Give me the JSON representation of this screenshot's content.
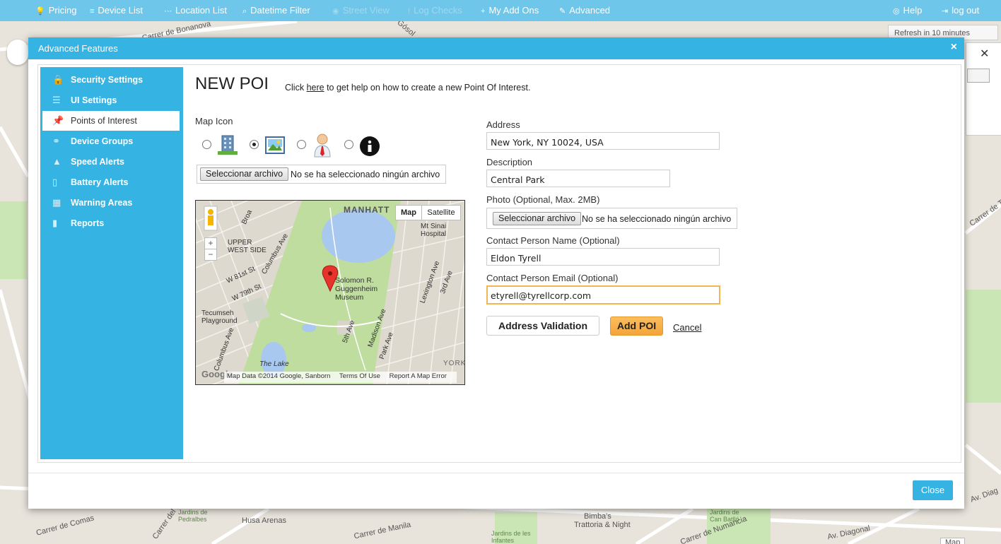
{
  "nav": {
    "items": [
      {
        "icon": "lightbulb-icon",
        "glyph": "💡",
        "label": "Pricing"
      },
      {
        "icon": "list-icon",
        "glyph": "≡",
        "label": "Device List"
      },
      {
        "icon": "dotted-list-icon",
        "glyph": "⋯",
        "label": "Location List"
      },
      {
        "icon": "search-icon",
        "glyph": "⌕",
        "label": "Datetime Filter"
      },
      {
        "icon": "eye-icon",
        "glyph": "◉",
        "label": "Street View"
      },
      {
        "icon": "exclamation-icon",
        "glyph": "!",
        "label": "Log Checks"
      },
      {
        "icon": "plus-icon",
        "glyph": "+",
        "label": "My Add Ons"
      },
      {
        "icon": "wrench-icon",
        "glyph": "✎",
        "label": "Advanced"
      }
    ],
    "help": "Help",
    "logout": "log out"
  },
  "background": {
    "refresh": "Refresh in 10 minutes",
    "labels": [
      "Carrer de Bonanova",
      "Gósol",
      "Carrer de Comas",
      "Husa Arenas",
      "Carrer de Manila",
      "Bimba's",
      "Trattoria & Night",
      "Jardins de Can Batlló",
      "Av. Diagonal",
      "Jardins de les Infantes",
      "Jardins de Pedralbes",
      "Carrer del Dr",
      "Carrer de Numancia",
      "Carrer de Tuset",
      "Av. Diag",
      "Map"
    ]
  },
  "modal": {
    "title": "Advanced Features",
    "close_x": "×",
    "close_button": "Close"
  },
  "sidebar": {
    "items": [
      {
        "icon": "lock-icon",
        "glyph": "🔒",
        "label": "Security Settings"
      },
      {
        "icon": "layers-icon",
        "glyph": "☰",
        "label": "UI Settings"
      },
      {
        "icon": "pushpin-icon",
        "glyph": "📌",
        "label": "Points of Interest"
      },
      {
        "icon": "group-icon",
        "glyph": "⚭",
        "label": "Device Groups"
      },
      {
        "icon": "warning-icon",
        "glyph": "▲",
        "label": "Speed Alerts"
      },
      {
        "icon": "battery-icon",
        "glyph": "▯",
        "label": "Battery Alerts"
      },
      {
        "icon": "map-area-icon",
        "glyph": "▦",
        "label": "Warning Areas"
      },
      {
        "icon": "bar-chart-icon",
        "glyph": "▮",
        "label": "Reports"
      }
    ]
  },
  "form": {
    "title": "NEW POI",
    "help_pre": "Click ",
    "help_link": "here",
    "help_post": " to get help on how to create a new Point Of Interest.",
    "map_icon_label": "Map Icon",
    "icon_options": [
      {
        "icon": "building-icon",
        "checked": false
      },
      {
        "icon": "picture-icon",
        "checked": true
      },
      {
        "icon": "person-icon",
        "checked": false
      },
      {
        "icon": "info-icon",
        "checked": false
      }
    ],
    "file_button": "Seleccionar archivo",
    "file_status": "No se ha seleccionado ningún archivo",
    "address_label": "Address",
    "address_value": "New York, NY 10024, USA",
    "description_label": "Description",
    "description_value": "Central Park",
    "photo_label": "Photo (Optional, Max. 2MB)",
    "photo_button": "Seleccionar archivo",
    "photo_status": "No se ha seleccionado ningún archivo",
    "contact_name_label": "Contact Person Name (Optional)",
    "contact_name_value": "Eldon Tyrell",
    "contact_email_label": "Contact Person Email (Optional)",
    "contact_email_value": "etyrell@tyrellcorp.com",
    "validate_button": "Address Validation",
    "add_button": "Add POI",
    "cancel_link": "Cancel"
  },
  "minimap": {
    "map_toggle": "Map",
    "satellite_toggle": "Satellite",
    "labels": {
      "manhattan": "MANHATT",
      "mtsinai": "Mt Sinai Hospital",
      "upperwest": "UPPER WEST SIDE",
      "w81": "W 81st St",
      "w79": "W 79th St",
      "columbus": "Columbus Ave",
      "broadway": "Broa",
      "guggenheim": "Solomon R. Guggenheim Museum",
      "tecumseh": "Tecumseh Playground",
      "lake": "The Lake",
      "fifth": "5th Ave",
      "madison": "Madison Ave",
      "park": "Park Ave",
      "lexington": "Lexington Ave",
      "third": "3rd Ave",
      "yorkv": "YORKV",
      "columbus2": "Columbus Ave"
    },
    "footer": [
      "Map Data ©2014 Google, Sanborn",
      "Terms Of Use",
      "Report A Map Error"
    ],
    "google": "Google"
  },
  "colors": {
    "nav": "#6ec6ea",
    "accent": "#35b3e3",
    "add_button": "#f3a43a"
  }
}
